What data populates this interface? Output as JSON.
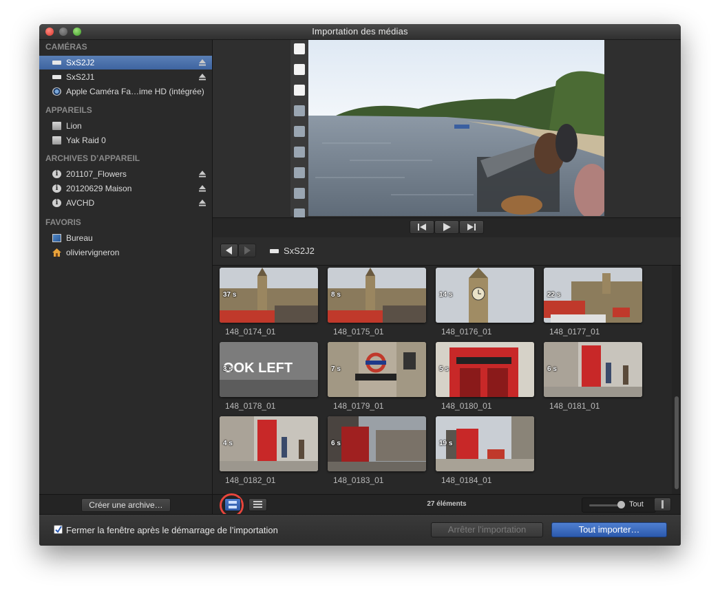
{
  "window": {
    "title": "Importation des médias"
  },
  "sidebar": {
    "sections": [
      {
        "header": "CAMÉRAS",
        "items": [
          {
            "label": "SxS2J2",
            "icon": "card-icon",
            "eject": true,
            "selected": true
          },
          {
            "label": "SxS2J1",
            "icon": "card-icon",
            "eject": true,
            "selected": false
          },
          {
            "label": "Apple Caméra Fa…ime HD (intégrée)",
            "icon": "camera-icon",
            "eject": false,
            "selected": false
          }
        ]
      },
      {
        "header": "APPAREILS",
        "items": [
          {
            "label": "Lion",
            "icon": "disk-icon",
            "eject": false,
            "selected": false
          },
          {
            "label": "Yak Raid 0",
            "icon": "disk-icon",
            "eject": false,
            "selected": false
          }
        ]
      },
      {
        "header": "ARCHIVES D’APPAREIL",
        "items": [
          {
            "label": "201107_Flowers",
            "icon": "archive-icon",
            "eject": true,
            "selected": false
          },
          {
            "label": "20120629 Maison",
            "icon": "archive-icon",
            "eject": true,
            "selected": false
          },
          {
            "label": "AVCHD",
            "icon": "archive-icon",
            "eject": true,
            "selected": false
          }
        ]
      },
      {
        "header": "FAVORIS",
        "items": [
          {
            "label": "Bureau",
            "icon": "desktop-icon",
            "eject": false,
            "selected": false
          },
          {
            "label": "oliviervigneron",
            "icon": "home-icon",
            "eject": false,
            "selected": false
          }
        ]
      }
    ],
    "create_archive_label": "Créer une archive…"
  },
  "navbar": {
    "source_name": "SxS2J2"
  },
  "clips": [
    {
      "name": "148_0174_01",
      "duration": "37 s",
      "scene": "westminster"
    },
    {
      "name": "148_0175_01",
      "duration": "8 s",
      "scene": "westminster"
    },
    {
      "name": "148_0176_01",
      "duration": "14 s",
      "scene": "bigben"
    },
    {
      "name": "148_0177_01",
      "duration": "22 s",
      "scene": "parliament-bus"
    },
    {
      "name": "148_0178_01",
      "duration": "3 s",
      "scene": "lookleft",
      "text": "OOK LEFT"
    },
    {
      "name": "148_0179_01",
      "duration": "7 s",
      "scene": "underground"
    },
    {
      "name": "148_0180_01",
      "duration": "5 s",
      "scene": "phonebox-close"
    },
    {
      "name": "148_0181_01",
      "duration": "6 s",
      "scene": "phonebox-street"
    },
    {
      "name": "148_0182_01",
      "duration": "4 s",
      "scene": "phonebox-street"
    },
    {
      "name": "148_0183_01",
      "duration": "6 s",
      "scene": "phonebox-dark"
    },
    {
      "name": "148_0184_01",
      "duration": "19 s",
      "scene": "phonebox-square"
    }
  ],
  "bottombar": {
    "count_label": "27 éléments",
    "zoom_label": "Tout",
    "zoom_level": 0.95
  },
  "footer": {
    "close_after_label": "Fermer la fenêtre après le démarrage de l’importation",
    "close_after_checked": true,
    "stop_import_label": "Arrêter l’importation",
    "import_all_label": "Tout importer…"
  },
  "colors": {
    "selection": "#4a6fad",
    "accent_blue": "#3a66b8",
    "highlight_ring": "#e8453c"
  }
}
